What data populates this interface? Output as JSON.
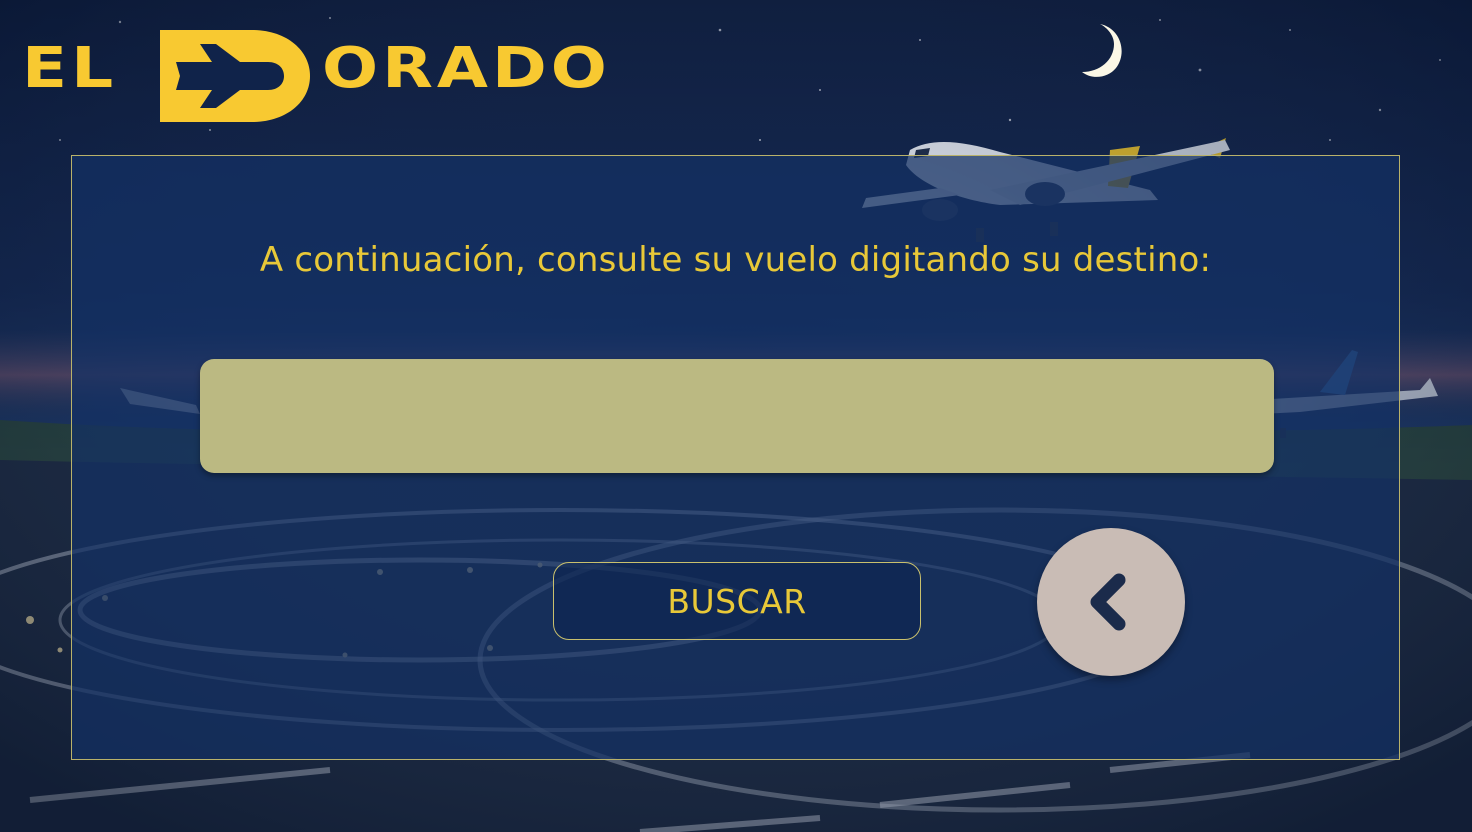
{
  "brand": {
    "name_left": "EL",
    "name_right": "ORADO",
    "color": "#f8c931"
  },
  "main": {
    "prompt": "A continuación, consulte su vuelo digitando su destino:",
    "destination_input": {
      "value": "",
      "placeholder": ""
    },
    "search_button_label": "BUSCAR",
    "back_button_icon": "chevron-left-icon"
  },
  "colors": {
    "accent": "#e8c838",
    "input_bg": "#bbb982",
    "panel_border": "#b9b26a",
    "back_button_bg": "#c9bcb5",
    "back_icon": "#1b2b4b"
  }
}
